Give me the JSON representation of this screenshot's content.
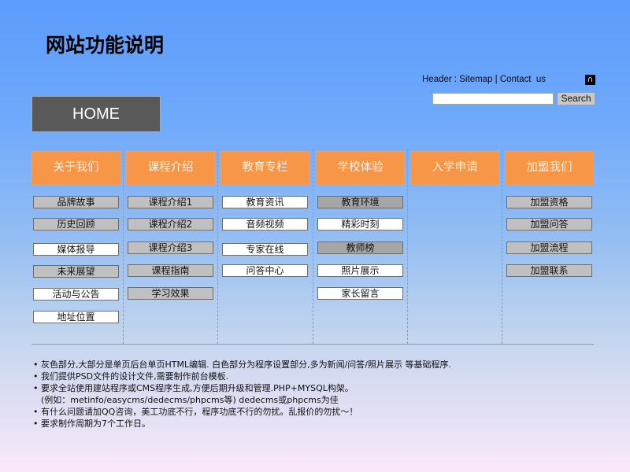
{
  "page": {
    "title": "网站功能说明"
  },
  "header": {
    "links_text": "Header : Sitemap | Contact  us",
    "icon": "headset-icon",
    "search": {
      "input_value": "",
      "button_label": "Search"
    }
  },
  "home": {
    "label": "HOME"
  },
  "nav": [
    {
      "label": "关于我们",
      "items": [
        {
          "label": "品牌故事",
          "style": "gray"
        },
        {
          "label": "历史回顾",
          "style": "gray"
        },
        {
          "label": "媒体报导",
          "style": "white"
        },
        {
          "label": "未来展望",
          "style": "gray"
        },
        {
          "label": "活动与公告",
          "style": "white"
        },
        {
          "label": "地址位置",
          "style": "white"
        }
      ]
    },
    {
      "label": "课程介绍",
      "items": [
        {
          "label": "课程介绍1",
          "style": "gray"
        },
        {
          "label": "课程介绍2",
          "style": "gray"
        },
        {
          "label": "课程介绍3",
          "style": "gray"
        },
        {
          "label": "课程指南",
          "style": "gray"
        },
        {
          "label": "学习效果",
          "style": "gray"
        }
      ]
    },
    {
      "label": "教育专栏",
      "items": [
        {
          "label": "教育资讯",
          "style": "white"
        },
        {
          "label": "音频视频",
          "style": "white"
        },
        {
          "label": "专家在线",
          "style": "white"
        },
        {
          "label": "问答中心",
          "style": "white"
        }
      ]
    },
    {
      "label": "学校体验",
      "items": [
        {
          "label": "教育环境",
          "style": "dgray"
        },
        {
          "label": "精彩时刻",
          "style": "white"
        },
        {
          "label": "教师榜",
          "style": "dgray"
        },
        {
          "label": "照片展示",
          "style": "white"
        },
        {
          "label": "家长留言",
          "style": "white"
        }
      ]
    },
    {
      "label": "入学申请",
      "items": []
    },
    {
      "label": "加盟我们",
      "items": [
        {
          "label": "加盟资格",
          "style": "gray"
        },
        {
          "label": "加盟问答",
          "style": "gray"
        },
        {
          "label": "加盟流程",
          "style": "gray"
        },
        {
          "label": "加盟联系",
          "style": "gray"
        }
      ]
    }
  ],
  "notes": [
    {
      "bullet": "•",
      "text": "灰色部分,大部分是单页后台单页HTML编辑.  白色部分为程序设置部分,多为新闻/问答/照片展示  等基础程序."
    },
    {
      "bullet": "•",
      "text": "我们提供PSD文件的设计文件,需要制作前台模板."
    },
    {
      "bullet": "•",
      "text": "要求全站使用建站程序或CMS程序生成,方便后期升级和管理.PHP+MYSQL构架。"
    },
    {
      "bullet": "",
      "text": "(例如：metinfo/easycms/dedecms/phpcms等)  dedecms或phpcms为佳"
    },
    {
      "bullet": "•",
      "text": "有什么问题请加QQ咨询，美工功底不行，程序功底不行的勿扰。乱报价的勿扰～！"
    },
    {
      "bullet": "•",
      "text": "要求制作周期为7个工作日。"
    }
  ]
}
